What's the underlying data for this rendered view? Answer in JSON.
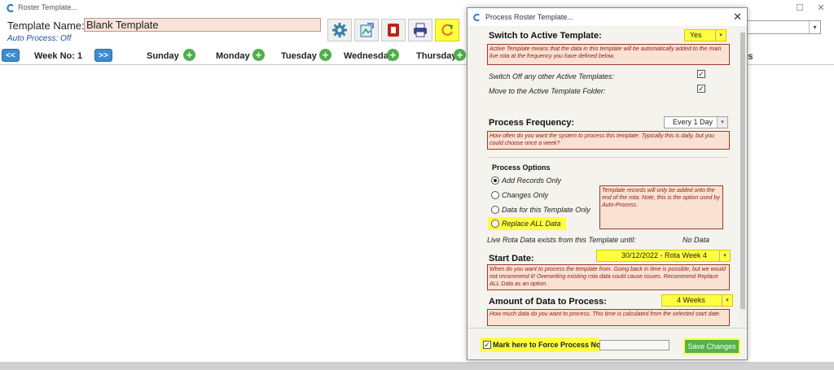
{
  "window": {
    "title": "Roster Template..."
  },
  "template": {
    "label": "Template Name:",
    "name": "Blank Template",
    "auto_process": "Auto Process: Off"
  },
  "toolbar": {
    "icons": [
      "settings-gear-icon",
      "export-icon",
      "delete-icon",
      "print-icon",
      "process-refresh-icon"
    ],
    "highlight_color": "#ffff40"
  },
  "week_nav": {
    "prev_label": "<<",
    "week_label": "Week No: 1",
    "next_label": ">>",
    "days": [
      "Sunday",
      "Monday",
      "Tuesday",
      "Wednesday",
      "Thursday"
    ]
  },
  "right_panel": {
    "partial_text": "s"
  },
  "dialog": {
    "title": "Process Roster Template...",
    "switch_active": {
      "header": "Switch to Active Template:",
      "value": "Yes",
      "note": "Active Template means that the data in this template will be automatically added to the main live rota at the frequency you have defined below."
    },
    "switch_off_label": "Switch Off any other Active Templates:",
    "switch_off_checked": true,
    "move_folder_label": "Move to the Active Template Folder:",
    "move_folder_checked": true,
    "frequency": {
      "header": "Process Frequency:",
      "value": "Every 1 Day",
      "note": "How often do you want the system to process this template.  Typically this is daily, but you could choose once a week?"
    },
    "options": {
      "header": "Process Options",
      "items": [
        "Add Records Only",
        "Changes Only",
        "Data for this Template Only",
        "Replace ALL Data"
      ],
      "selected_index": 0,
      "note": "Template records will only be added onto the end of the rota.  Note, this is the option used by Auto-Process."
    },
    "live_rota_label": "Live Rota Data exists from this Template until:",
    "live_rota_value": "No Data",
    "start_date": {
      "header": "Start Date:",
      "value": "30/12/2022 - Rota Week 4",
      "note": "When do you want to process the template from.  Going back in time is possible, but we would not recommend it!  Overwriting existing rota data could cause issues.  Recommend Replace ALL Data as an option."
    },
    "amount": {
      "header": "Amount of Data to Process:",
      "value": "4 Weeks",
      "note": "How much data do you want to process.  This time is calculated from the selected start date."
    },
    "force_label": "Mark here to Force Process Now",
    "force_checked": true,
    "save_label": "Save Changes"
  }
}
